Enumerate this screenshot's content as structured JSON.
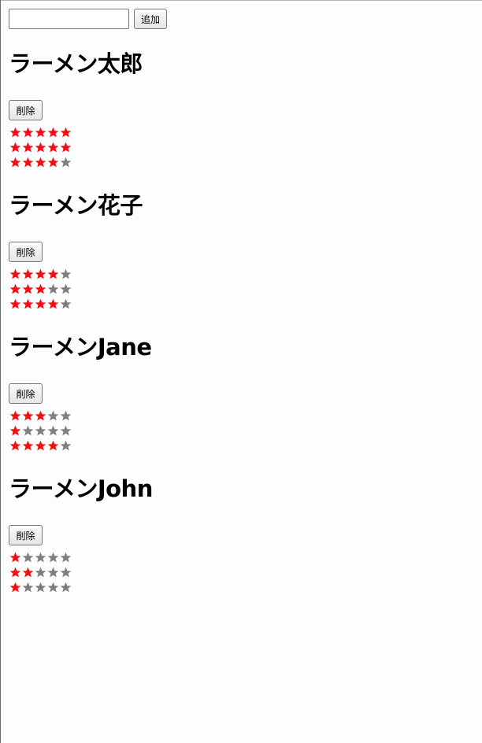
{
  "form": {
    "input_value": "",
    "input_placeholder": "",
    "add_label": "追加"
  },
  "colors": {
    "star_on": "#ee1111",
    "star_off": "#7f7f7f"
  },
  "shops": [
    {
      "name": "ラーメン太郎",
      "delete_label": "削除",
      "ratings": [
        5,
        5,
        4
      ]
    },
    {
      "name": "ラーメン花子",
      "delete_label": "削除",
      "ratings": [
        4,
        3,
        4
      ]
    },
    {
      "name": "ラーメンJane",
      "delete_label": "削除",
      "ratings": [
        3,
        1,
        4
      ]
    },
    {
      "name": "ラーメンJohn",
      "delete_label": "削除",
      "ratings": [
        1,
        2,
        1
      ]
    }
  ]
}
